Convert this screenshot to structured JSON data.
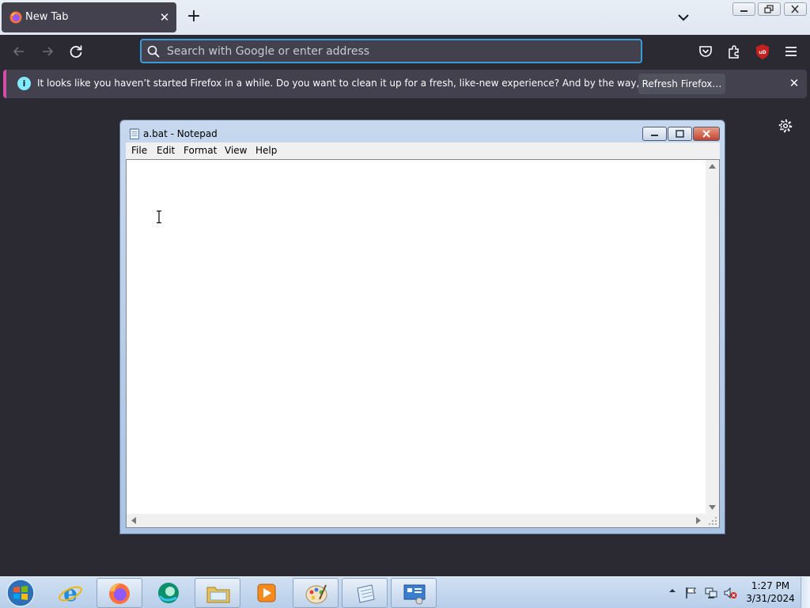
{
  "firefox": {
    "tab_title": "New Tab",
    "url_placeholder": "Search with Google or enter address",
    "notification": {
      "message": "It looks like you haven’t started Firefox in a while. Do you want to clean it up for a fresh, like-new experience? And by the way, welcome back!",
      "button_label": "Refresh Firefox…"
    },
    "extension_badge": "uD"
  },
  "notepad": {
    "title": "a.bat - Notepad",
    "menu": [
      "File",
      "Edit",
      "Format",
      "View",
      "Help"
    ],
    "content": ""
  },
  "taskbar": {
    "apps": [
      "internet-explorer",
      "firefox",
      "edge",
      "file-explorer",
      "media-player",
      "paint",
      "notepad",
      "control-panel"
    ],
    "clock": {
      "time": "1:27 PM",
      "date": "3/31/2024"
    }
  },
  "colors": {
    "accent": "#3a9bd9",
    "notif_stripe": "#d44da6",
    "info": "#80ebff",
    "ublock": "#c42121"
  }
}
